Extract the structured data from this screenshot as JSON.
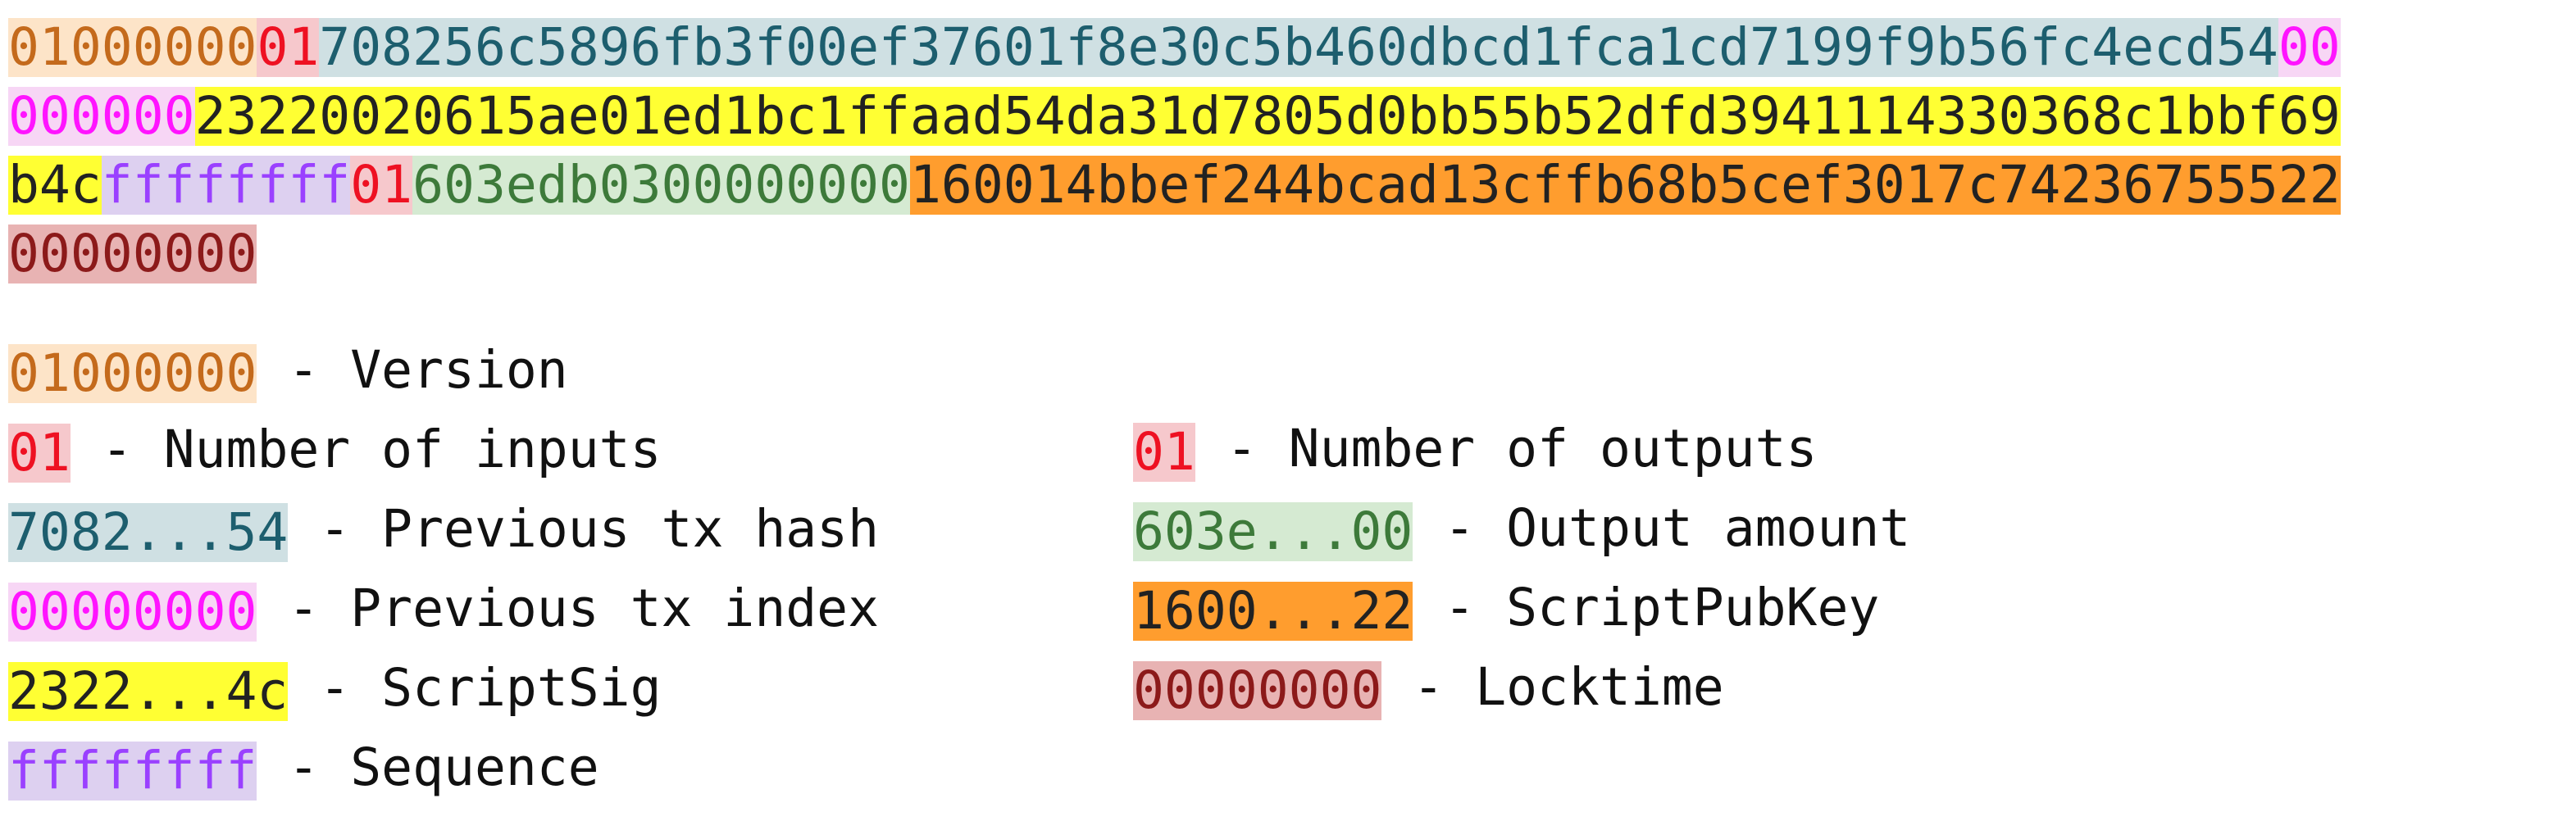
{
  "hex_lines": [
    [
      {
        "text": "01000000",
        "field": "version"
      },
      {
        "text": "01",
        "field": "count"
      },
      {
        "text": "708256c5896fb3f00ef37601f8e30c5b460dbcd1fca1cd7199f9b56fc4ecd54",
        "field": "hash"
      },
      {
        "text": "00",
        "field": "index"
      }
    ],
    [
      {
        "text": "000000",
        "field": "index"
      },
      {
        "text": "23220020615ae01ed1bc1ffaad54da31d7805d0bb55b52dfd3941114330368c1bbf69",
        "field": "sig"
      }
    ],
    [
      {
        "text": "b4c",
        "field": "sig"
      },
      {
        "text": "ffffffff",
        "field": "seq"
      },
      {
        "text": "01",
        "field": "count"
      },
      {
        "text": "603edb0300000000",
        "field": "amount"
      },
      {
        "text": "160014bbef244bcad13cffb68b5cef3017c74236755522",
        "field": "spk"
      }
    ],
    [
      {
        "text": "00000000",
        "field": "lock"
      }
    ]
  ],
  "legend_left": [
    {
      "code": "01000000",
      "label": "- Version",
      "field": "version"
    },
    {
      "code": "01",
      "label": "- Number of inputs",
      "field": "count"
    },
    {
      "code": "7082...54",
      "label": "- Previous tx hash",
      "field": "hash"
    },
    {
      "code": "00000000",
      "label": "- Previous tx index",
      "field": "index"
    },
    {
      "code": "2322...4c",
      "label": "- ScriptSig",
      "field": "sig"
    },
    {
      "code": "ffffffff",
      "label": "- Sequence",
      "field": "seq"
    }
  ],
  "legend_right": [
    {
      "code": "01",
      "label": "- Number of outputs",
      "field": "count"
    },
    {
      "code": "603e...00",
      "label": "- Output amount",
      "field": "amount"
    },
    {
      "code": "1600...22",
      "label": "- ScriptPubKey",
      "field": "spk"
    },
    {
      "code": "00000000",
      "label": "- Locktime",
      "field": "lock"
    }
  ],
  "colors": {
    "version": {
      "fg": "#c46a1c",
      "bg": "#fde4c8"
    },
    "count": {
      "fg": "#ee1122",
      "bg": "#f6c8cc"
    },
    "hash": {
      "fg": "#1d5e6e",
      "bg": "#cfe0e3"
    },
    "index": {
      "fg": "#ff14ff",
      "bg": "#f7d6f5"
    },
    "sig": {
      "fg": "#222222",
      "bg": "#ffff33"
    },
    "seq": {
      "fg": "#9a40ff",
      "bg": "#ddd0f0"
    },
    "amount": {
      "fg": "#3d7a3a",
      "bg": "#d5ead2"
    },
    "spk": {
      "fg": "#222222",
      "bg": "#ff9d2e"
    },
    "lock": {
      "fg": "#8c1a1a",
      "bg": "#e8b3b3"
    }
  }
}
